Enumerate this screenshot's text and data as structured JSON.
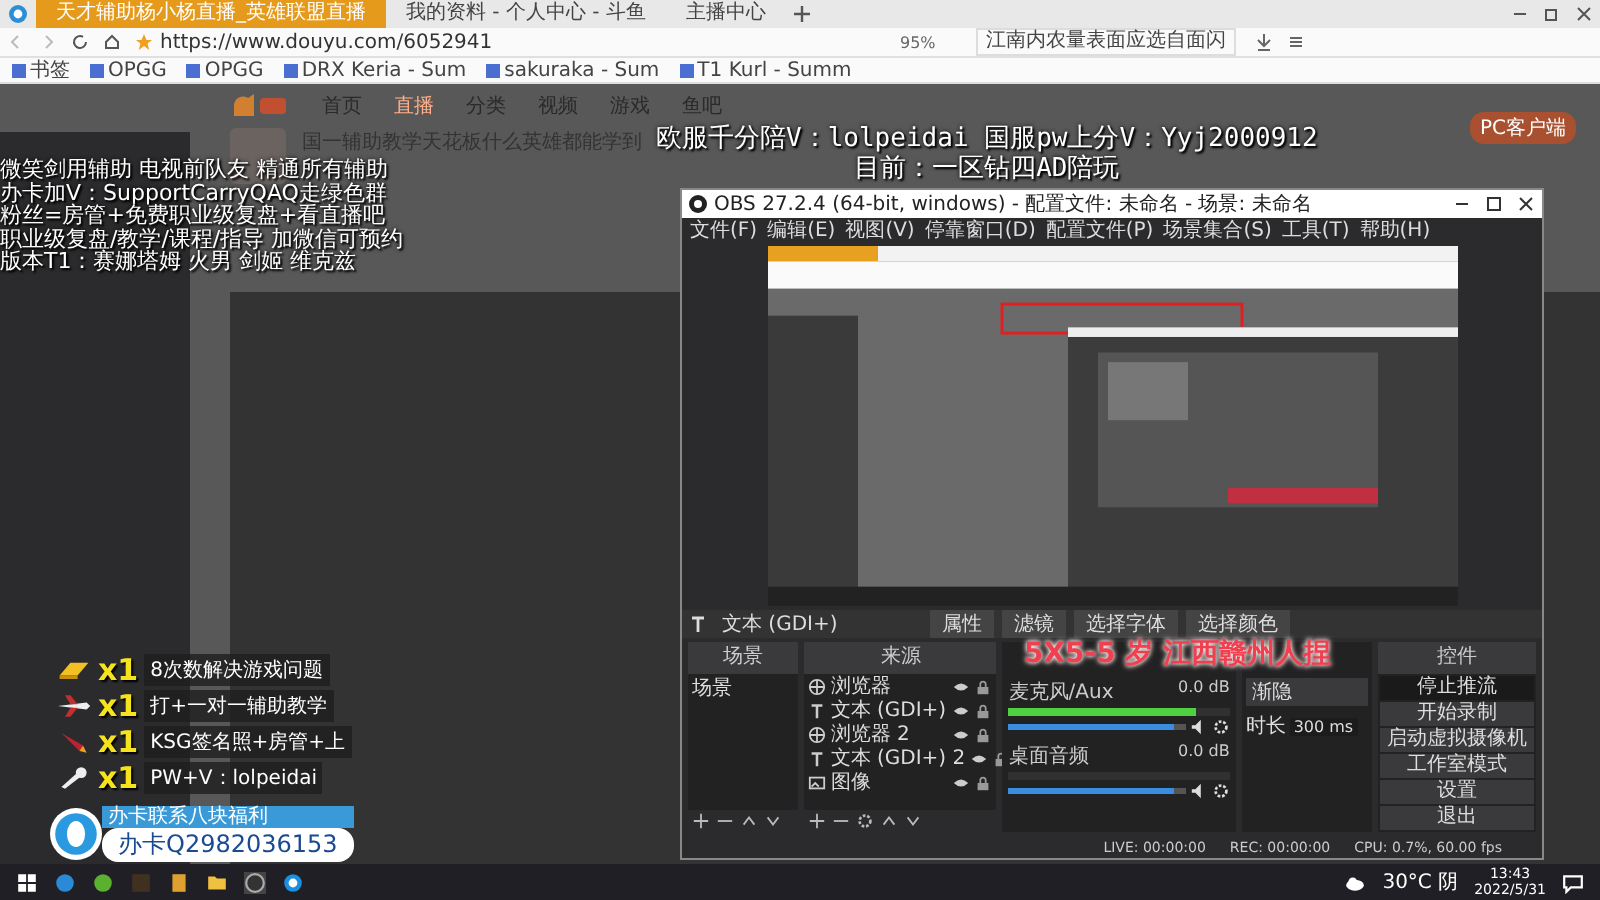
{
  "browser": {
    "tabs": [
      {
        "label": "天才辅助杨小杨直播_英雄联盟直播",
        "selected": true
      },
      {
        "label": "我的资料 - 个人中心 - 斗鱼",
        "selected": false
      },
      {
        "label": "主播中心",
        "selected": false
      }
    ],
    "url": "https://www.douyu.com/6052941",
    "zoom": "95%",
    "search": "江南内农量表面应选自面闪"
  },
  "bookmarks": [
    {
      "label": "书签"
    },
    {
      "label": "OPGG"
    },
    {
      "label": "OPGG"
    },
    {
      "label": "DRX Keria - Sum"
    },
    {
      "label": "sakuraka - Sum"
    },
    {
      "label": "T1 Kurl - Summ"
    }
  ],
  "site": {
    "nav": [
      {
        "label": "首页",
        "selected": false
      },
      {
        "label": "直播",
        "selected": true
      },
      {
        "label": "分类",
        "selected": false
      },
      {
        "label": "视频",
        "selected": false
      },
      {
        "label": "游戏",
        "selected": false
      },
      {
        "label": "鱼吧",
        "selected": false
      }
    ],
    "stream_title": "国一辅助教学天花板什么英雄都能学到",
    "client_button": "PC客户端"
  },
  "overlay": {
    "top_lines": [
      "欧服千分陪V：lolpeidai 国服pw上分V：Yyj2000912",
      "目前：一区钻四AD陪玩"
    ],
    "left_lines": [
      "微笑剑用辅助 电视前队友 精通所有辅助",
      "办卡加V：SupportCarryQAQ走绿色群",
      "粉丝=房管+免费职业级复盘+看直播吧",
      "职业级复盘/教学/课程/指导 加微信可预约",
      "版本T1：赛娜塔姆 火男 剑姬 维克兹"
    ],
    "caption": "5X5-5 岁 江西赣州人捏",
    "gifts": [
      {
        "kind": "gold",
        "count": "x1",
        "text": "8次数解决游戏问题"
      },
      {
        "kind": "plane",
        "count": "x1",
        "text": "打+一对一辅助教学"
      },
      {
        "kind": "rocket",
        "count": "x1",
        "text": "KSG签名照+房管+上"
      },
      {
        "kind": "wrench",
        "count": "x1",
        "text": "PW+V：lolpeidai"
      }
    ],
    "qq": {
      "label": "办卡联系八块福利",
      "number": "办卡Q2982036153"
    }
  },
  "obs": {
    "title": "OBS 27.2.4 (64-bit, windows) - 配置文件: 未命名 - 场景: 未命名",
    "menu": [
      "文件(F)",
      "编辑(E)",
      "视图(V)",
      "停靠窗口(D)",
      "配置文件(P)",
      "场景集合(S)",
      "工具(T)",
      "帮助(H)"
    ],
    "selected_source": "文本 (GDI+)",
    "toolbar": [
      "属性",
      "滤镜",
      "选择字体",
      "选择颜色"
    ],
    "scenes_title": "场景",
    "scenes": [
      "场景"
    ],
    "sources_title": "来源",
    "sources": [
      {
        "kind": "browser",
        "name": "浏览器"
      },
      {
        "kind": "text",
        "name": "文本 (GDI+)"
      },
      {
        "kind": "browser",
        "name": "浏览器 2"
      },
      {
        "kind": "text",
        "name": "文本 (GDI+) 2"
      },
      {
        "kind": "image",
        "name": "图像"
      }
    ],
    "mixer": [
      {
        "name": "麦克风/Aux",
        "reading": "0.0 dB",
        "meter": {
          "level": 0.85
        },
        "fader": {
          "level": 0.93
        }
      },
      {
        "name": "桌面音频",
        "reading": "0.0 dB",
        "fader": {
          "level": 0.93
        }
      }
    ],
    "transition": {
      "name": "渐隐",
      "duration_label": "时长",
      "duration": "300 ms"
    },
    "controls_title": "控件",
    "controls": [
      "停止推流",
      "开始录制",
      "启动虚拟摄像机",
      "工作室模式",
      "设置",
      "退出"
    ],
    "status": [
      "LIVE: 00:00:00",
      "REC: 00:00:00",
      "CPU: 0.7%, 60.00 fps"
    ]
  },
  "taskbar": {
    "weather": "30°C 阴",
    "time": "13:43",
    "date": "2022/5/31"
  }
}
